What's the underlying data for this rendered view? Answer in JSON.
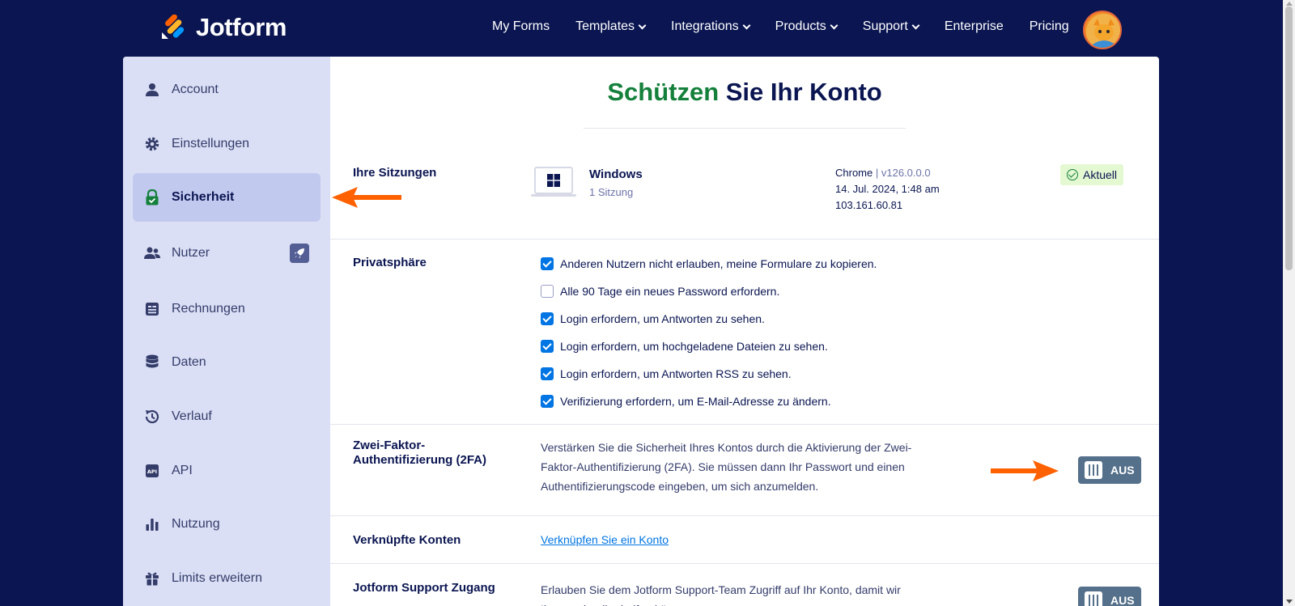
{
  "brand": {
    "name": "Jotform"
  },
  "nav": {
    "items": [
      {
        "label": "My Forms",
        "dropdown": false
      },
      {
        "label": "Templates",
        "dropdown": true
      },
      {
        "label": "Integrations",
        "dropdown": true
      },
      {
        "label": "Products",
        "dropdown": true
      },
      {
        "label": "Support",
        "dropdown": true
      },
      {
        "label": "Enterprise",
        "dropdown": false
      },
      {
        "label": "Pricing",
        "dropdown": false
      }
    ]
  },
  "sidebar": {
    "items": [
      {
        "label": "Account",
        "icon": "user-icon",
        "active": false
      },
      {
        "label": "Einstellungen",
        "icon": "gear-icon",
        "active": false
      },
      {
        "label": "Sicherheit",
        "icon": "lock-icon",
        "active": true
      },
      {
        "label": "Nutzer",
        "icon": "users-icon",
        "active": false,
        "extra": "rocket-icon"
      },
      {
        "label": "Rechnungen",
        "icon": "invoice-icon",
        "active": false
      },
      {
        "label": "Daten",
        "icon": "database-icon",
        "active": false
      },
      {
        "label": "Verlauf",
        "icon": "history-icon",
        "active": false
      },
      {
        "label": "API",
        "icon": "api-icon",
        "active": false
      },
      {
        "label": "Nutzung",
        "icon": "bar-chart-icon",
        "active": false
      },
      {
        "label": "Limits erweitern",
        "icon": "gift-icon",
        "active": false
      }
    ]
  },
  "page": {
    "title_highlight": "Schützen",
    "title_rest": " Sie Ihr Konto"
  },
  "sessions": {
    "label": "Ihre Sitzungen",
    "os": "Windows",
    "count": "1 Sitzung",
    "browser": "Chrome",
    "separator": " | ",
    "version": "v126.0.0.0",
    "date": "14. Jul. 2024, 1:48 am",
    "ip": "103.161.60.81",
    "badge": "Aktuell"
  },
  "privacy": {
    "label": "Privatsphäre",
    "options": [
      {
        "label": "Anderen Nutzern nicht erlauben, meine Formulare zu kopieren.",
        "checked": true
      },
      {
        "label": "Alle 90 Tage ein neues Password erfordern.",
        "checked": false
      },
      {
        "label": "Login erfordern, um Antworten zu sehen.",
        "checked": true
      },
      {
        "label": "Login erfordern, um hochgeladene Dateien zu sehen.",
        "checked": true
      },
      {
        "label": "Login erfordern, um Antworten RSS zu sehen.",
        "checked": true
      },
      {
        "label": "Verifizierung erfordern, um E-Mail-Adresse zu ändern.",
        "checked": true
      }
    ]
  },
  "twofa": {
    "label_line1": "Zwei-Faktor-",
    "label_line2": "Authentifizierung (2FA)",
    "description": "Verstärken Sie die Sicherheit Ihres Kontos durch die Aktivierung der Zwei-Faktor-Authentifizierung (2FA). Sie müssen dann Ihr Passwort und einen Authentifizierungscode eingeben, um sich anzumelden.",
    "toggle": "AUS"
  },
  "linked": {
    "label": "Verknüpfte Konten",
    "link": "Verknüpfen Sie ein Konto"
  },
  "support_access": {
    "label": "Jotform Support Zugang",
    "description": "Erlauben Sie dem Jotform Support-Team Zugriff auf Ihr Konto, damit wir Ihnen schneller helfen können.",
    "toggle": "AUS"
  },
  "colors": {
    "nav_bg": "#0a1551",
    "sidebar_bg": "#dadff5",
    "active_item": "#c2c9ef",
    "accent_green": "#14803b",
    "arrow": "#ff6100",
    "toggle_off": "#55708a",
    "checkbox": "#0075e3"
  }
}
